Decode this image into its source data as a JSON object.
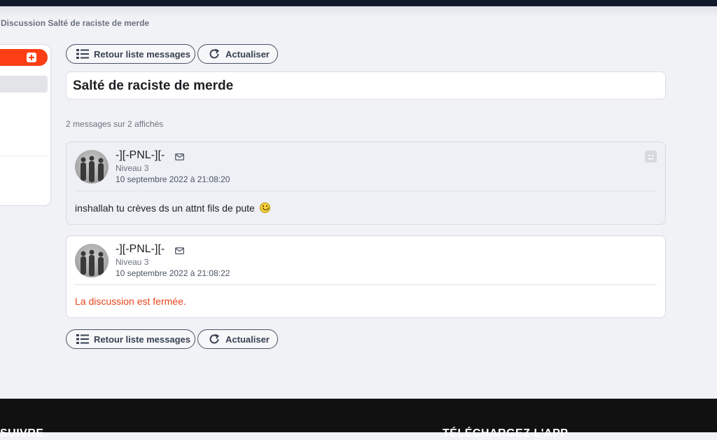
{
  "breadcrumb": "Discussion Salté de raciste de merde",
  "actions": {
    "back_label": "Retour liste messages",
    "refresh_label": "Actualiser"
  },
  "topic": {
    "title": "Salté de raciste de merde",
    "count_text": "2 messages sur 2 affichés"
  },
  "messages": [
    {
      "author": "-][-PNL-][-",
      "level": "Niveau 3",
      "date": "10 septembre 2022 à 21:08:20",
      "text": "inshallah tu crèves ds un attnt fils de pute"
    },
    {
      "author": "-][-PNL-][-",
      "level": "Niveau 3",
      "date": "10 septembre 2022 à 21:08:22",
      "text": "La discussion est fermée."
    }
  ],
  "footer": {
    "follow_heading": "SUIVRE",
    "app_heading": "TÉLÉCHARGEZ L'APP"
  },
  "colors": {
    "accent": "#fe3e14",
    "closed_text": "#e8441b",
    "footer_bg": "#111112",
    "topbar_bg": "#111a2c"
  }
}
